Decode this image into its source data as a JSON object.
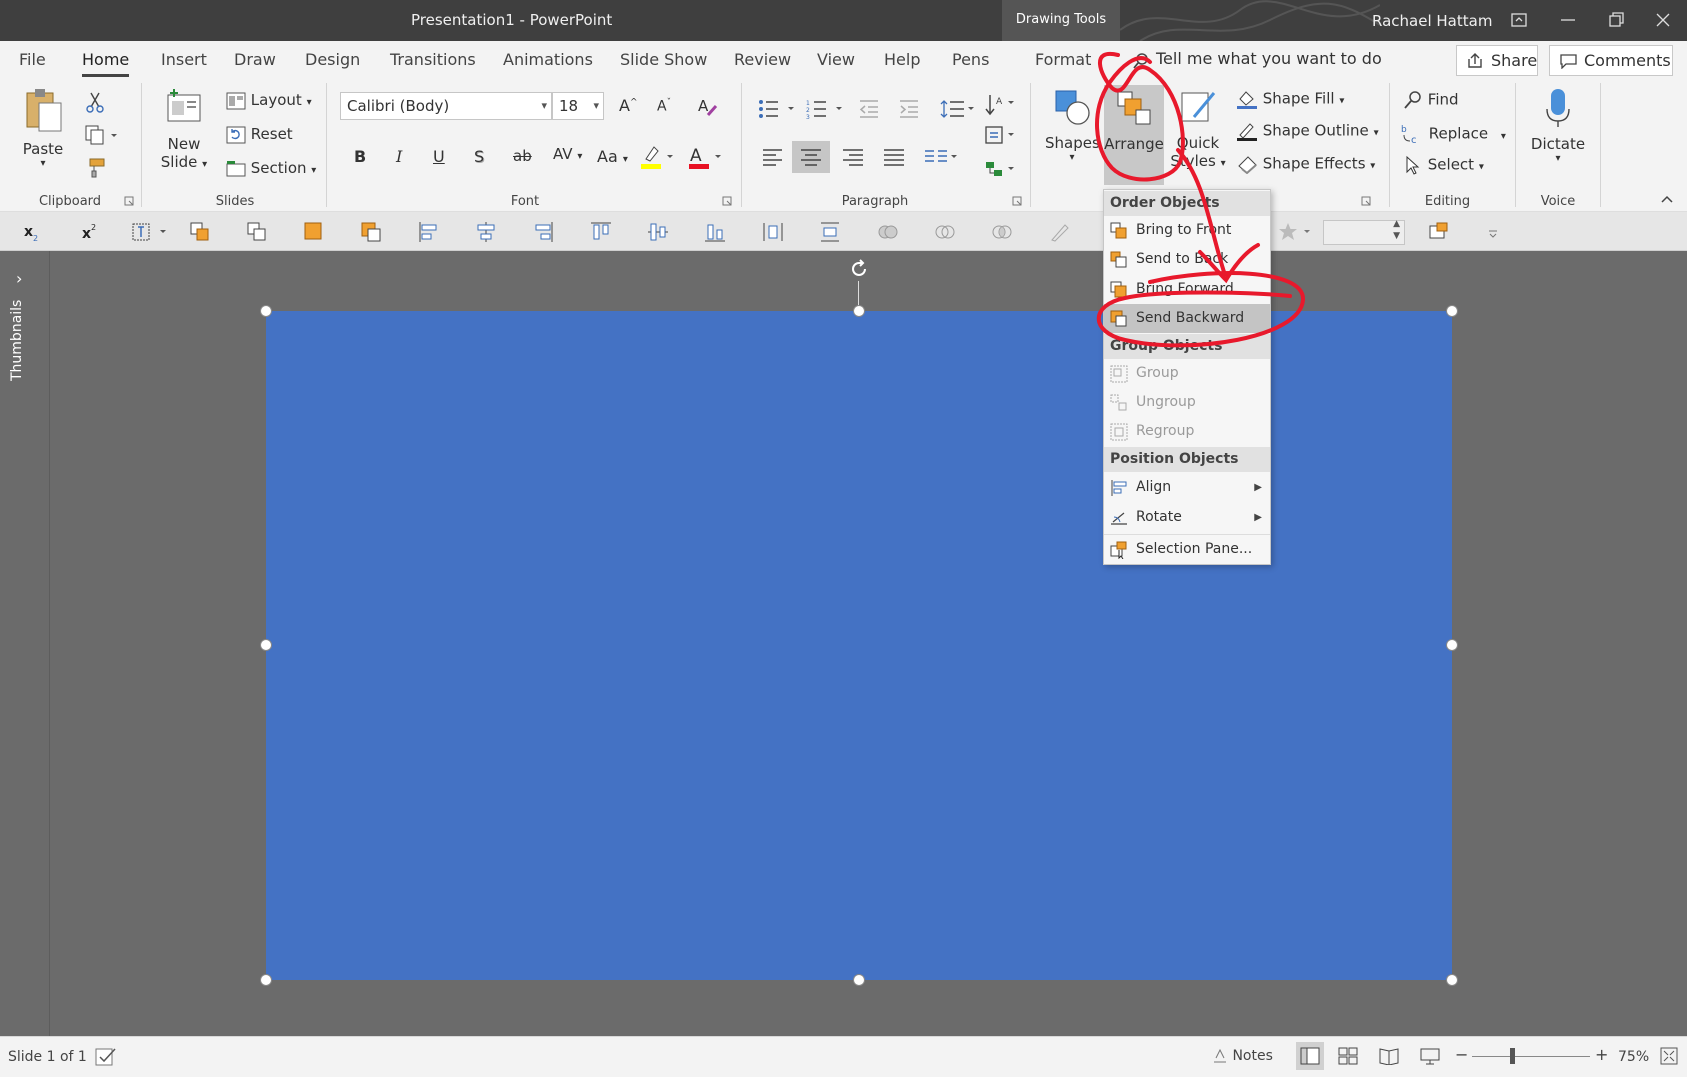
{
  "window": {
    "title": "Presentation1  -  PowerPoint",
    "context_tab": "Drawing Tools",
    "user": "Rachael Hattam"
  },
  "tabs": [
    "File",
    "Home",
    "Insert",
    "Draw",
    "Design",
    "Transitions",
    "Animations",
    "Slide Show",
    "Review",
    "View",
    "Help",
    "Pens",
    "Format"
  ],
  "tell_me": "Tell me what you want to do",
  "share_label": "Share",
  "comments_label": "Comments",
  "ribbon": {
    "clipboard": {
      "label": "Clipboard",
      "paste": "Paste"
    },
    "slides": {
      "label": "Slides",
      "new_slide_line1": "New",
      "new_slide_line2": "Slide",
      "layout": "Layout",
      "reset": "Reset",
      "section": "Section"
    },
    "font": {
      "label": "Font",
      "font_name": "Calibri (Body)",
      "font_size": "18"
    },
    "paragraph": {
      "label": "Paragraph"
    },
    "drawing": {
      "shapes": "Shapes",
      "arrange": "Arrange",
      "quick_line1": "Quick",
      "quick_line2": "Styles",
      "shape_fill": "Shape Fill",
      "shape_outline": "Shape Outline",
      "shape_effects": "Shape Effects"
    },
    "editing": {
      "label": "Editing",
      "find": "Find",
      "replace": "Replace",
      "select": "Select"
    },
    "voice": {
      "label": "Voice",
      "dictate": "Dictate"
    }
  },
  "thumbnails_label": "Thumbnails",
  "arrange_menu": {
    "order_header": "Order Objects",
    "bring_to_front": "Bring to Front",
    "send_to_back": "Send to Back",
    "bring_forward": "Bring Forward",
    "send_backward": "Send Backward",
    "group_header": "Group Objects",
    "group": "Group",
    "ungroup": "Ungroup",
    "regroup": "Regroup",
    "position_header": "Position Objects",
    "align": "Align",
    "rotate": "Rotate",
    "selection_pane": "Selection Pane..."
  },
  "status": {
    "slide_info": "Slide 1 of 1",
    "notes": "Notes",
    "zoom": "75%"
  },
  "colors": {
    "slide_shape": "#4472c4",
    "annotation": "#e8192c",
    "titlebar": "#3f3f3f"
  }
}
